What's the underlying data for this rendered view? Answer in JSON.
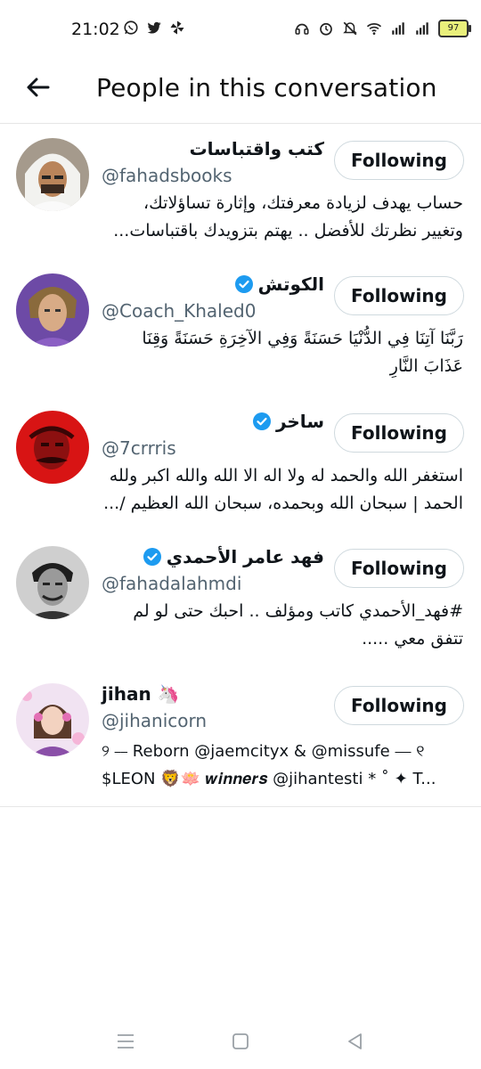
{
  "status_bar": {
    "time": "21:02",
    "left_icons": [
      "whatsapp-icon",
      "twitter-icon",
      "pinwheel-icon"
    ],
    "right_icons": [
      "headset-icon",
      "alarm-icon",
      "mute-icon",
      "wifi-icon",
      "signal-icon",
      "signal-icon"
    ],
    "battery_level": "97"
  },
  "header": {
    "title": "People in this conversation",
    "back_icon": "arrow-left-icon"
  },
  "users": [
    {
      "name": "كتب واقتباسات",
      "verified": false,
      "handle": "@fahadsbooks",
      "bio_lines": [
        "حساب يهدف لزيادة معرفتك، وإثارة تساؤلاتك،",
        "وتغيير نظرتك للأفضل .. يهتم بتزويدك باقتباسات..."
      ],
      "bio_rtl": true,
      "follow_label": "Following"
    },
    {
      "name": "الكوتش",
      "verified": true,
      "handle": "@Coach_Khaled0",
      "bio_lines": [
        "رَبَّنَا آتِنَا فِي الدُّنْيَا حَسَنَةً وَفِي الآخِرَةِ حَسَنَةً وَقِنَا",
        "عَذَابَ النَّارِ"
      ],
      "bio_rtl": true,
      "follow_label": "Following"
    },
    {
      "name": "ساخر",
      "verified": true,
      "handle": "@7crrris",
      "bio_lines": [
        "استغفر الله والحمد له ولا اله الا الله والله اكبر ولله",
        "الحمد | سبحان الله وبحمده، سبحان الله العظيم /..."
      ],
      "bio_rtl": true,
      "follow_label": "Following"
    },
    {
      "name": "فهد عامر الأحمدي",
      "verified": true,
      "handle": "@fahadalahmdi",
      "bio_lines": [
        "#فهد_الأحمدي كاتب ومؤلف .. احبك حتى لو لم",
        "تتفق معي ....."
      ],
      "bio_rtl": true,
      "follow_label": "Following"
    },
    {
      "name": "jihan 🦄",
      "verified": false,
      "handle": "@jihanicorn",
      "bio_lines": [
        "୨ ⎯⎯ Reborn @jaemcityx & @missufe ⎯⎯ ୧",
        "$LEON 🦁🪷 𝒘𝒊𝒏𝒏𝒆𝒓𝒔 @jihantesti * ˚ ✦ T..."
      ],
      "bio_rtl": false,
      "follow_label": "Following"
    }
  ],
  "nav_bar": {
    "icons": [
      "menu-icon",
      "home-icon",
      "back-icon"
    ]
  },
  "colors": {
    "verified": "#1d9bf0",
    "handle": "#536471",
    "text": "#0f1419",
    "divider": "#e6e6e6"
  }
}
